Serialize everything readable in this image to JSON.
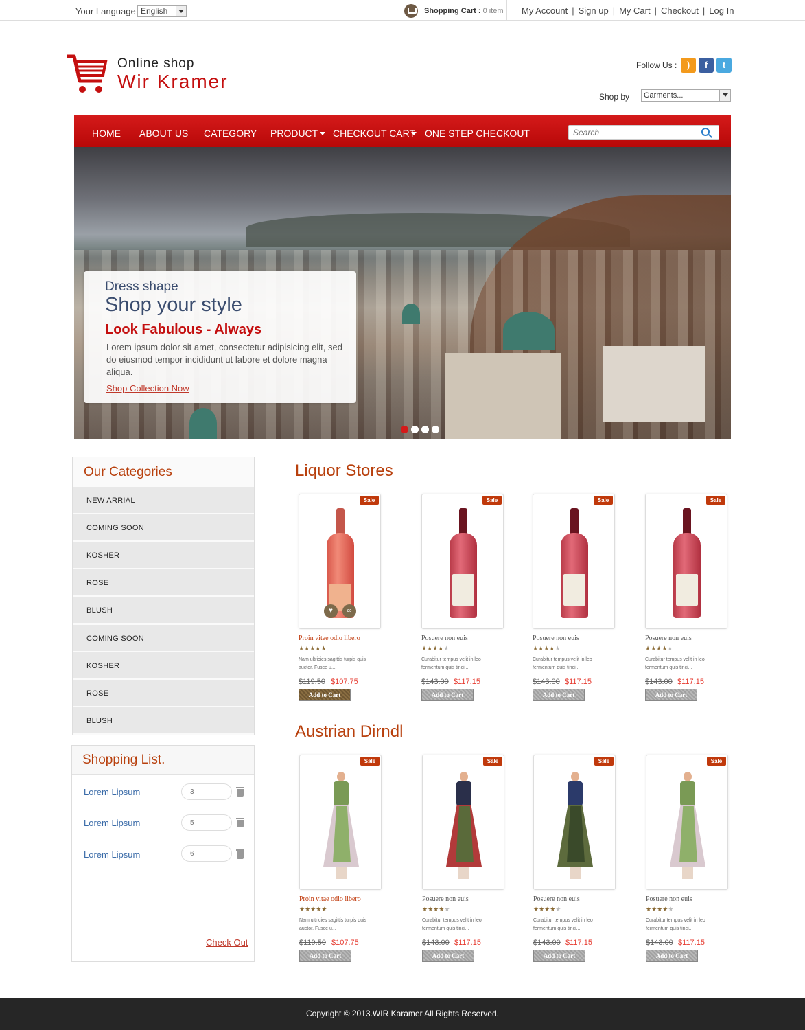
{
  "topbar": {
    "language_label": "Your Language",
    "language_value": "English",
    "cart_label": "Shopping Cart :",
    "cart_count": "0 item",
    "links": [
      "My Account",
      "Sign up",
      "My Cart",
      "Checkout",
      "Log In"
    ]
  },
  "header": {
    "logo_small": "Online shop",
    "logo_big": "Wir Kramer",
    "follow_label": "Follow Us :",
    "shop_by_label": "Shop by",
    "shop_by_value": "Garments..."
  },
  "nav": {
    "items": [
      "HOME",
      "ABOUT US",
      "CATEGORY",
      "PRODUCT",
      "CHECKOUT CART",
      "ONE STEP CHECKOUT"
    ],
    "search_placeholder": "Search"
  },
  "hero": {
    "subtitle": "Dress shape",
    "title": "Shop your style",
    "tagline": "Look Fabulous - Always",
    "description": "Lorem ipsum dolor sit amet, consectetur adipisicing elit, sed do eiusmod tempor incididunt ut labore et dolore magna aliqua.",
    "link": "Shop Collection Now",
    "active_slide": 1,
    "slide_count": 4
  },
  "categories": {
    "title": "Our Categories",
    "items": [
      "NEW ARRIAL",
      "COMING SOON",
      "KOSHER",
      "ROSE",
      "BLUSH",
      "COMING SOON",
      "KOSHER",
      "ROSE",
      "BLUSH"
    ]
  },
  "shopping_list": {
    "title": "Shopping List.",
    "items": [
      {
        "name": "Lorem Lipsum",
        "qty": "3"
      },
      {
        "name": "Lorem Lipsum",
        "qty": "5"
      },
      {
        "name": "Lorem Lipsum",
        "qty": "6"
      }
    ],
    "checkout": "Check Out"
  },
  "sections": [
    {
      "title": "Liquor Stores",
      "products": [
        {
          "badge": "Sale",
          "name": "Proin vitae odio libero",
          "rating": 5,
          "desc": "Nam ultricies sagittis turpis quis auctor. Fusce u...",
          "old_price": "$119.50",
          "new_price": "$107.75",
          "button": "Add to Cart"
        },
        {
          "badge": "Sale",
          "name": "Posuere non euis",
          "rating": 4,
          "desc": "Curabitur tempus velit in leo fermentum quis tinci...",
          "old_price": "$143.00",
          "new_price": "$117.15",
          "button": "Add to Cart"
        },
        {
          "badge": "Sale",
          "name": "Posuere non euis",
          "rating": 4,
          "desc": "Curabitur tempus velit in leo fermentum quis tinci...",
          "old_price": "$143.00",
          "new_price": "$117.15",
          "button": "Add to Cart"
        },
        {
          "badge": "Sale",
          "name": "Posuere non euis",
          "rating": 4,
          "desc": "Curabitur tempus velit in leo fermentum quis tinci...",
          "old_price": "$143.00",
          "new_price": "$117.15",
          "button": "Add to Cart"
        }
      ]
    },
    {
      "title": "Austrian Dirndl",
      "products": [
        {
          "badge": "Sale",
          "name": "Proin vitae odio libero",
          "rating": 5,
          "desc": "Nam ultricies sagittis turpis quis auctor. Fusce u...",
          "old_price": "$119.50",
          "new_price": "$107.75",
          "button": "Add to Cart"
        },
        {
          "badge": "Sale",
          "name": "Posuere non euis",
          "rating": 4,
          "desc": "Curabitur tempus velit in leo fermentum quis tinci...",
          "old_price": "$143.00",
          "new_price": "$117.15",
          "button": "Add to Cart"
        },
        {
          "badge": "Sale",
          "name": "Posuere non euis",
          "rating": 4,
          "desc": "Curabitur tempus velit in leo fermentum quis tinci...",
          "old_price": "$143.00",
          "new_price": "$117.15",
          "button": "Add to Cart"
        },
        {
          "badge": "Sale",
          "name": "Posuere non euis",
          "rating": 4,
          "desc": "Curabitur tempus velit in leo fermentum quis tinci...",
          "old_price": "$143.00",
          "new_price": "$117.15",
          "button": "Add to Cart"
        }
      ]
    }
  ],
  "footer": {
    "copyright": "Copyright © 2013.WIR Karamer All Rights Reserved."
  },
  "colors": {
    "brand_red": "#c40f0f",
    "section_orange": "#b8400d",
    "price_red": "#e63a2f",
    "footer_bg": "#262626"
  }
}
